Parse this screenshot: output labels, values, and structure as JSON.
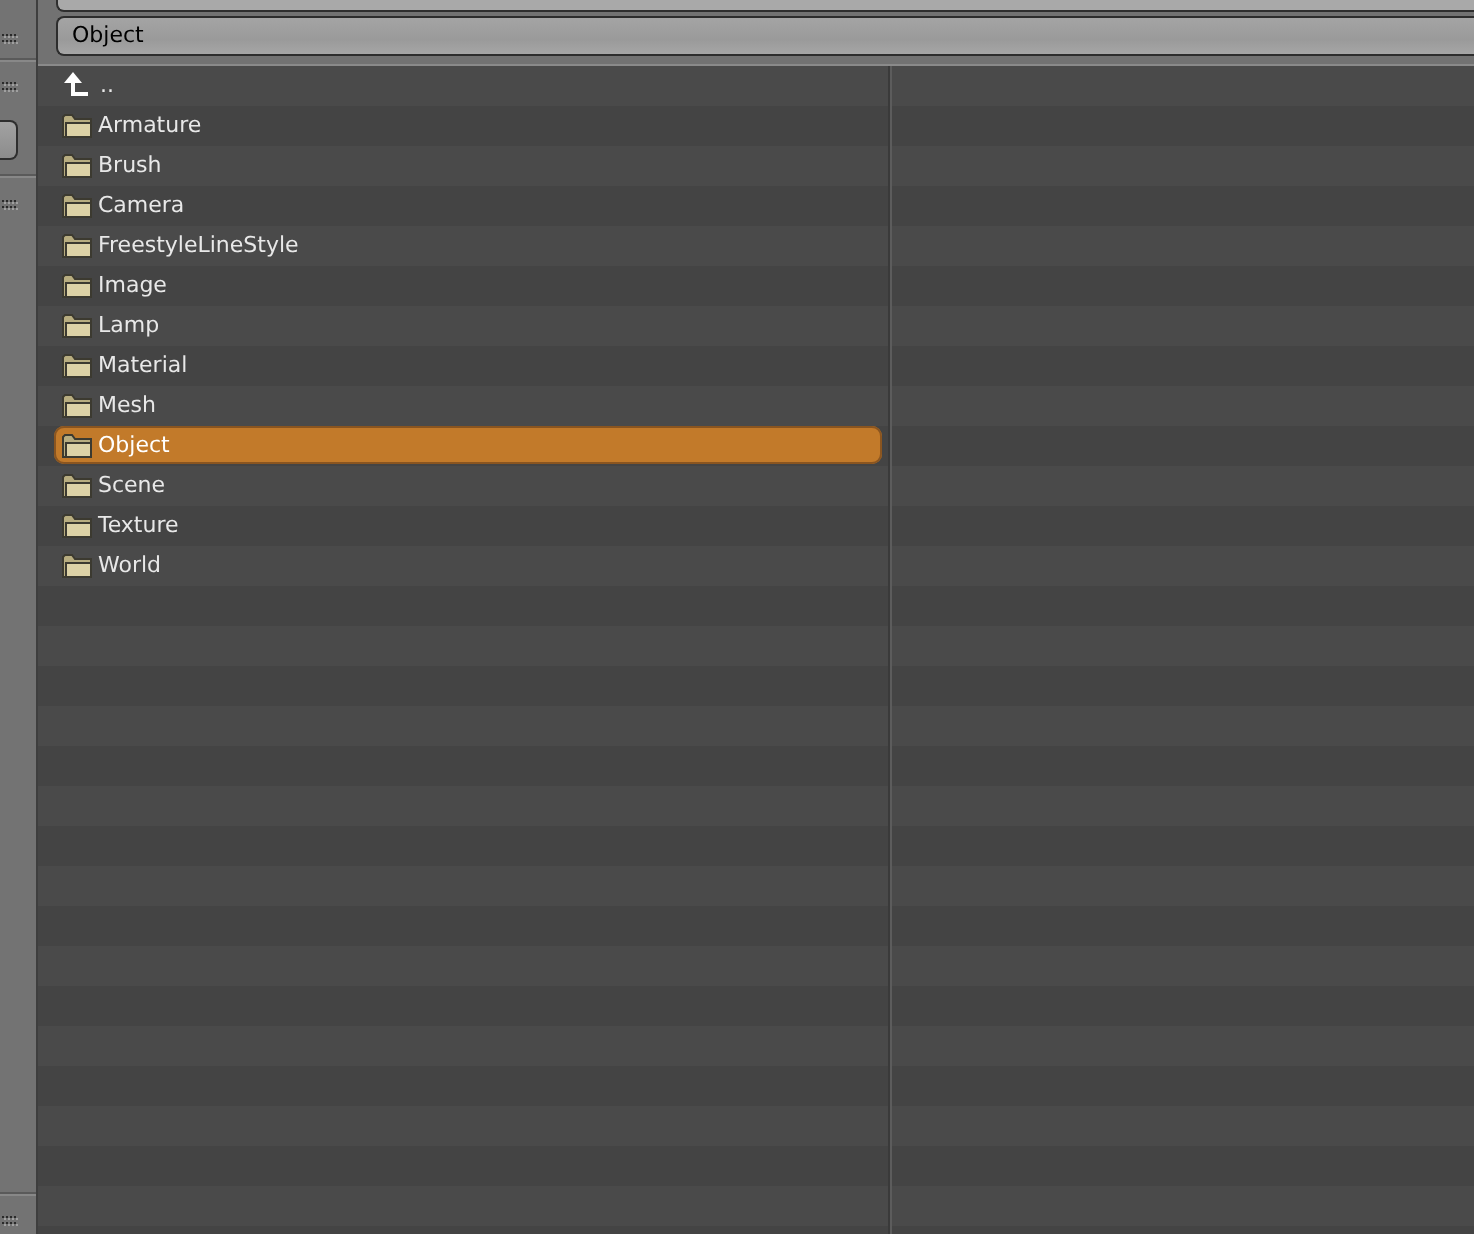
{
  "path_field": {
    "value": "Object"
  },
  "file_list": {
    "items": [
      {
        "kind": "parent",
        "name": "..",
        "selected": false
      },
      {
        "kind": "folder",
        "name": "Armature",
        "selected": false
      },
      {
        "kind": "folder",
        "name": "Brush",
        "selected": false
      },
      {
        "kind": "folder",
        "name": "Camera",
        "selected": false
      },
      {
        "kind": "folder",
        "name": "FreestyleLineStyle",
        "selected": false
      },
      {
        "kind": "folder",
        "name": "Image",
        "selected": false
      },
      {
        "kind": "folder",
        "name": "Lamp",
        "selected": false
      },
      {
        "kind": "folder",
        "name": "Material",
        "selected": false
      },
      {
        "kind": "folder",
        "name": "Mesh",
        "selected": false
      },
      {
        "kind": "folder",
        "name": "Object",
        "selected": true
      },
      {
        "kind": "folder",
        "name": "Scene",
        "selected": false
      },
      {
        "kind": "folder",
        "name": "Texture",
        "selected": false
      },
      {
        "kind": "folder",
        "name": "World",
        "selected": false
      }
    ]
  }
}
